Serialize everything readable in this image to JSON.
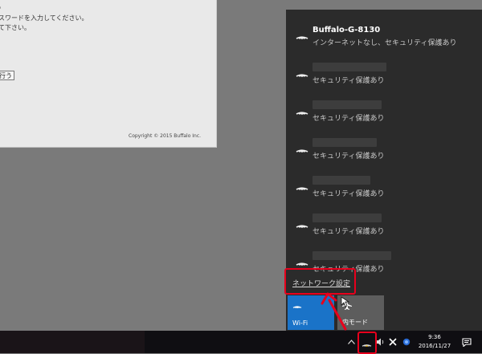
{
  "browser": {
    "line1": "。",
    "line2": "スワードを入力してください。",
    "line3": "て下さい。",
    "button": "行う",
    "copyright": "Copyright © 2015 Buffalo Inc."
  },
  "networks": [
    {
      "name": "Buffalo-G-8130",
      "status": "インターネットなし、セキュリティ保護あり"
    },
    {
      "name": "",
      "status": "セキュリティ保護あり"
    },
    {
      "name": "",
      "status": "セキュリティ保護あり"
    },
    {
      "name": "",
      "status": "セキュリティ保護あり"
    },
    {
      "name": "",
      "status": "セキュリティ保護あり"
    },
    {
      "name": "",
      "status": "セキュリティ保護あり"
    },
    {
      "name": "",
      "status": "セキュリティ保護あり"
    }
  ],
  "network_settings": "ネットワーク設定",
  "tiles": {
    "wifi": "Wi-Fi",
    "airplane": "内モード"
  },
  "clock": {
    "time": "9:36",
    "date": "2016/11/27"
  },
  "colors": {
    "panel": "#2b2b2b",
    "accent": "#1a73c8",
    "highlight": "#e8001c"
  }
}
